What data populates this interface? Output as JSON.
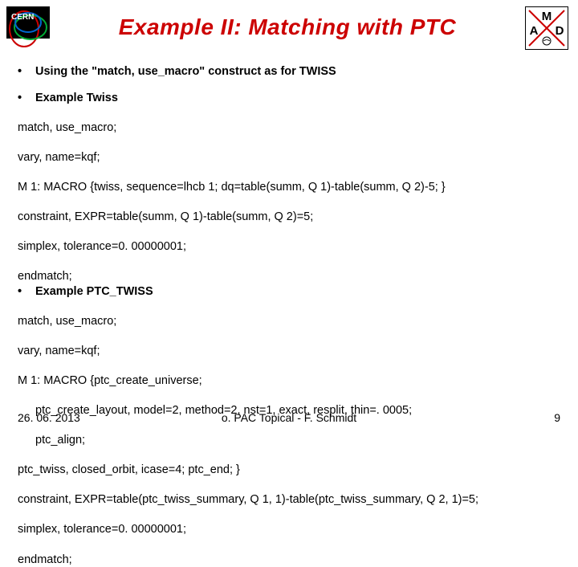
{
  "title": "Example II: Matching with PTC",
  "bullets": {
    "intro": "Using the \"match, use_macro\" construct as for TWISS",
    "twiss_head": "Example Twiss",
    "ptc_head": "Example PTC_TWISS"
  },
  "code_twiss": {
    "l1": "match, use_macro;",
    "l2": "vary, name=kqf;",
    "l3": "M 1: MACRO {twiss, sequence=lhcb 1; dq=table(summ, Q 1)-table(summ, Q 2)-5; }",
    "l4": "constraint, EXPR=table(summ, Q 1)-table(summ, Q 2)=5;",
    "l5": "simplex, tolerance=0. 00000001;",
    "l6": "endmatch;"
  },
  "code_ptc": {
    "l1": "match, use_macro;",
    "l2": "vary, name=kqf;",
    "l3": "M 1: MACRO {ptc_create_universe;",
    "l4": "ptc_create_layout, model=2, method=2, nst=1, exact, resplit, thin=. 0005;",
    "l5": "ptc_align;",
    "l6": "ptc_twiss, closed_orbit, icase=4; ptc_end; }",
    "l7": "constraint, EXPR=table(ptc_twiss_summary, Q 1, 1)-table(ptc_twiss_summary, Q 2, 1)=5;",
    "l8": "simplex, tolerance=0. 00000001;",
    "l9": "endmatch;"
  },
  "footer": {
    "date": "26. 06. 2013",
    "center": "o. PAC Topical - F. Schmidt",
    "page": "9"
  },
  "logo_right": {
    "M": "M",
    "A": "A",
    "D": "D"
  }
}
